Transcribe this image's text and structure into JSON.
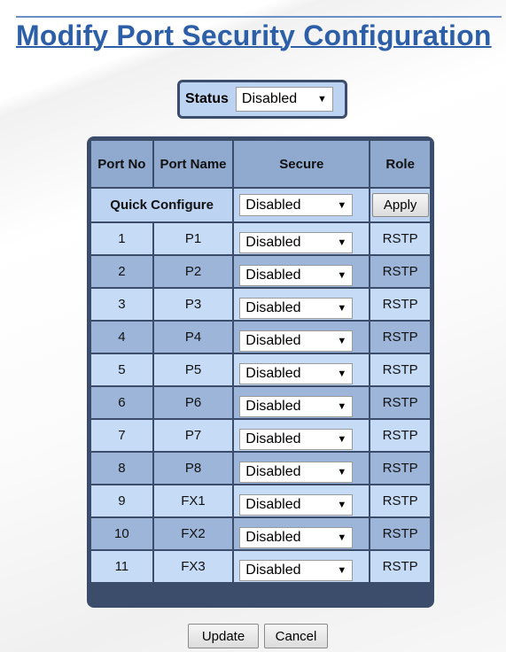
{
  "page": {
    "title": "Modify Port Security Configuration"
  },
  "status": {
    "label": "Status",
    "value": "Disabled"
  },
  "table": {
    "headers": {
      "port_no": "Port No",
      "port_name": "Port Name",
      "secure": "Secure",
      "role": "Role"
    },
    "quick_configure": {
      "label": "Quick Configure",
      "value": "Disabled",
      "apply_label": "Apply"
    },
    "rows": [
      {
        "no": "1",
        "name": "P1",
        "secure": "Disabled",
        "role": "RSTP"
      },
      {
        "no": "2",
        "name": "P2",
        "secure": "Disabled",
        "role": "RSTP"
      },
      {
        "no": "3",
        "name": "P3",
        "secure": "Disabled",
        "role": "RSTP"
      },
      {
        "no": "4",
        "name": "P4",
        "secure": "Disabled",
        "role": "RSTP"
      },
      {
        "no": "5",
        "name": "P5",
        "secure": "Disabled",
        "role": "RSTP"
      },
      {
        "no": "6",
        "name": "P6",
        "secure": "Disabled",
        "role": "RSTP"
      },
      {
        "no": "7",
        "name": "P7",
        "secure": "Disabled",
        "role": "RSTP"
      },
      {
        "no": "8",
        "name": "P8",
        "secure": "Disabled",
        "role": "RSTP"
      },
      {
        "no": "9",
        "name": "FX1",
        "secure": "Disabled",
        "role": "RSTP"
      },
      {
        "no": "10",
        "name": "FX2",
        "secure": "Disabled",
        "role": "RSTP"
      },
      {
        "no": "11",
        "name": "FX3",
        "secure": "Disabled",
        "role": "RSTP"
      }
    ]
  },
  "actions": {
    "update_label": "Update",
    "cancel_label": "Cancel"
  },
  "colors": {
    "title": "#2c5fa8",
    "frame": "#3b4d6b",
    "header_bg": "#8fa9cf",
    "row_light": "#c6dbf6",
    "row_dark": "#9cb5d8"
  },
  "icons": {
    "select_arrow": "dropdown-arrow-icon"
  }
}
